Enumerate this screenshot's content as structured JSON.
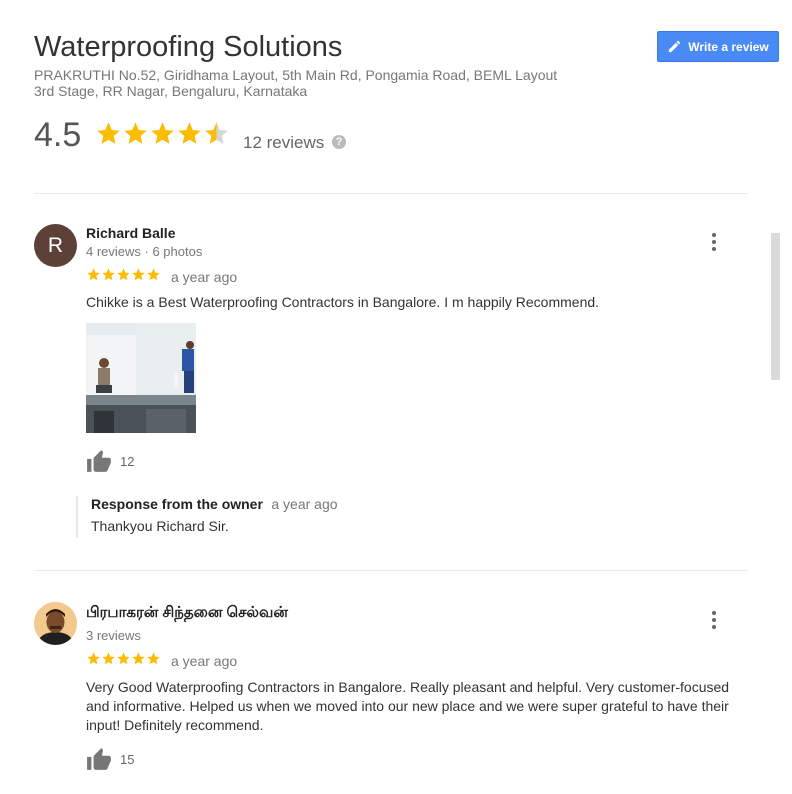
{
  "place": {
    "title": "Waterproofing Solutions",
    "address_line1": "PRAKRUTHI No.52, Giridhama Layout, 5th Main Rd, Pongamia Road, BEML Layout",
    "address_line2": "3rd Stage, RR Nagar, Bengaluru, Karnataka",
    "rating": "4.5",
    "rating_value": 4.5,
    "review_count": "12 reviews",
    "help_icon": "?"
  },
  "actions": {
    "write_review": "Write a review"
  },
  "colors": {
    "star": "#fbbc04",
    "star_empty": "#d6d6d6",
    "accent": "#4a8af4"
  },
  "reviews": [
    {
      "author": "Richard Balle",
      "avatar_letter": "R",
      "meta": "4 reviews · 6 photos",
      "stars": 5,
      "time": "a year ago",
      "text": "Chikke is a Best Waterproofing Contractors in Bangalore. I m happily Recommend.",
      "likes": "12",
      "owner_response": {
        "title": "Response from the owner",
        "time": "a year ago",
        "text": "Thankyou Richard Sir."
      }
    },
    {
      "author": "பிரபாகரன் சிந்தனை செல்வன்",
      "meta": "3 reviews",
      "stars": 5,
      "time": "a year ago",
      "text": "Very Good  Waterproofing Contractors in Bangalore.  Really pleasant and helpful. Very customer-focused and informative. Helped us when we moved into our new place and we were super grateful to have their input! Definitely recommend.",
      "likes": "15"
    }
  ]
}
